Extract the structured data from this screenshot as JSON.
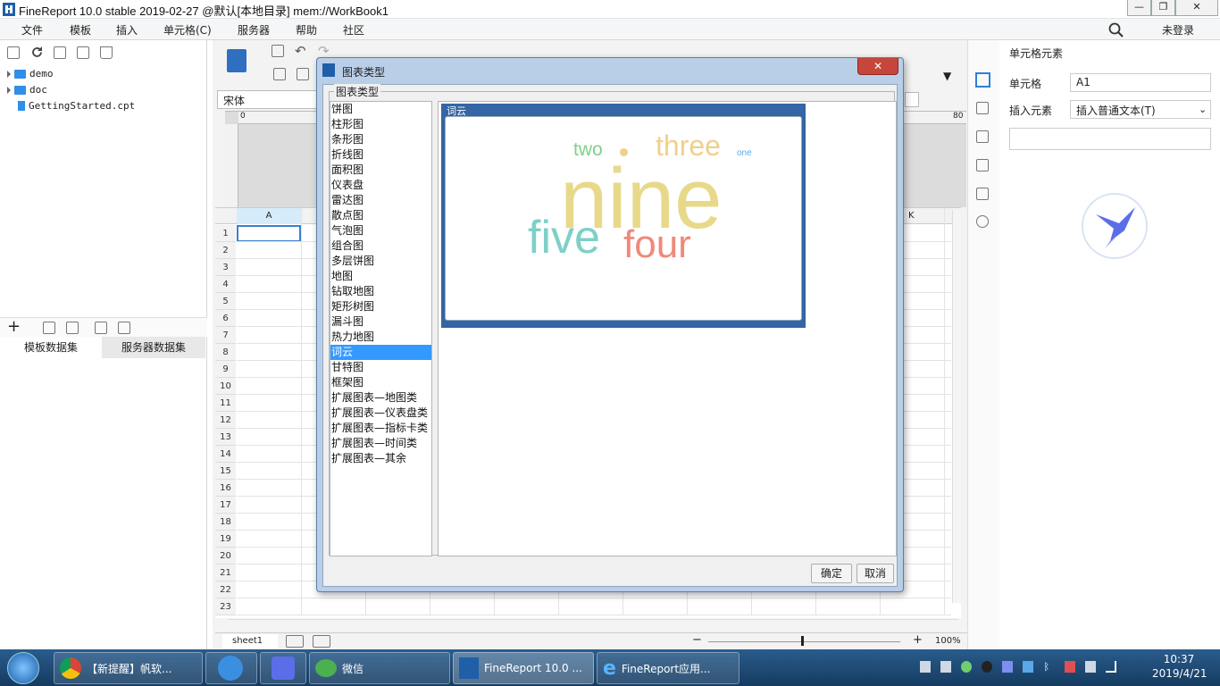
{
  "window": {
    "title": "FineReport 10.0 stable 2019-02-27 @默认[本地目录]    mem://WorkBook1",
    "minimize": "—",
    "maximize": "❐",
    "close": "✕"
  },
  "menu": {
    "items": [
      "文件",
      "模板",
      "插入",
      "单元格(C)",
      "服务器",
      "帮助",
      "社区"
    ],
    "login": "未登录"
  },
  "file_tree": {
    "items": [
      {
        "name": "demo",
        "type": "folder"
      },
      {
        "name": "doc",
        "type": "folder"
      },
      {
        "name": "GettingStarted.cpt",
        "type": "file"
      }
    ]
  },
  "dataset_tabs": [
    "模板数据集",
    "服务器数据集"
  ],
  "editor": {
    "font_name": "宋体",
    "ruler_left": "0",
    "ruler_right": "80",
    "col_a": "A",
    "col_k": "K",
    "rows": [
      "1",
      "2",
      "3",
      "4",
      "5",
      "6",
      "7",
      "8",
      "9",
      "10",
      "11",
      "12",
      "13",
      "14",
      "15",
      "16",
      "17",
      "18",
      "19",
      "20",
      "21",
      "22",
      "23"
    ],
    "sheet_tab": "sheet1",
    "zoom": "100%",
    "zoom_minus": "−",
    "zoom_plus": "+"
  },
  "right_panel": {
    "title": "单元格元素",
    "cell_label": "单元格",
    "cell_value": "A1",
    "insert_label": "插入元素",
    "insert_value": "插入普通文本(T)"
  },
  "dialog": {
    "title": "图表类型",
    "group_label": "图表类型",
    "chart_types": [
      "饼图",
      "柱形图",
      "条形图",
      "折线图",
      "面积图",
      "仪表盘",
      "雷达图",
      "散点图",
      "气泡图",
      "组合图",
      "多层饼图",
      "地图",
      "钻取地图",
      "矩形树图",
      "漏斗图",
      "热力地图",
      "词云",
      "甘特图",
      "框架图",
      "扩展图表—地图类",
      "扩展图表—仪表盘类",
      "扩展图表—指标卡类",
      "扩展图表—时间类",
      "扩展图表—其余"
    ],
    "selected_index": 16,
    "preview_label": "词云",
    "ok": "确定",
    "cancel": "取消"
  },
  "word_cloud": {
    "words": [
      {
        "text": "nine",
        "color": "#e8d98a"
      },
      {
        "text": "five",
        "color": "#7ed0c6"
      },
      {
        "text": "four",
        "color": "#f0897a"
      },
      {
        "text": "three",
        "color": "#f0d08a"
      },
      {
        "text": "two",
        "color": "#7fd08a"
      },
      {
        "text": "one",
        "color": "#5aa8e8"
      }
    ]
  },
  "taskbar": {
    "items": [
      "【新提醒】帆软...",
      "微信",
      "FineReport 10.0 ...",
      "FineReport应用..."
    ],
    "time": "10:37",
    "date": "2019/4/21"
  },
  "colors": {
    "accent": "#3399ff",
    "card_blue": "#3465a4",
    "folder": "#2f8ee8"
  }
}
